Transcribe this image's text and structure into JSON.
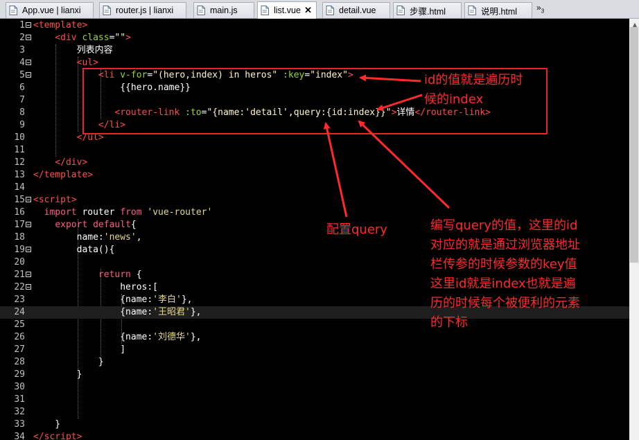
{
  "tabs": [
    {
      "label": "App.vue | lianxi",
      "active": false
    },
    {
      "label": "router.js | lianxi",
      "active": false
    },
    {
      "label": "main.js",
      "active": false
    },
    {
      "label": "list.vue",
      "active": true
    },
    {
      "label": "detail.vue",
      "active": false
    },
    {
      "label": "步骤.html",
      "active": false
    },
    {
      "label": "说明.html",
      "active": false
    }
  ],
  "tab_overflow": "»",
  "tab_overflow_count": "3",
  "code_lines": [
    {
      "n": "1",
      "fold": true,
      "t": "<span class='tg'>&lt;template&gt;</span>"
    },
    {
      "n": "2",
      "fold": true,
      "t": "    <span class='tg'>&lt;div</span> <span class='at'>class</span>=<span class='st'>\"\"</span><span class='tg'>&gt;</span>"
    },
    {
      "n": "3",
      "fold": false,
      "t": "        <span class='cn'>列表内容</span>"
    },
    {
      "n": "4",
      "fold": true,
      "t": "        <span class='tg'>&lt;ul&gt;</span>"
    },
    {
      "n": "5",
      "fold": true,
      "t": "            <span class='tg'>&lt;li</span> <span class='at'>v-for</span>=<span class='st'>\"(hero,index) in heros\"</span> <span class='at'>:key</span>=<span class='st'>\"index\"</span><span class='tg'>&gt;</span>"
    },
    {
      "n": "6",
      "fold": false,
      "t": "                {{hero.name}}"
    },
    {
      "n": "7",
      "fold": false,
      "t": ""
    },
    {
      "n": "8",
      "fold": false,
      "t": "               <span class='tg'>&lt;router-link</span> <span class='at'>:to</span>=<span class='st'>\"{name:'detail',query:{id:index}}\"</span><span class='tg'>&gt;</span><span class='cn'>详情</span><span class='tg'>&lt;/router-link&gt;</span>"
    },
    {
      "n": "9",
      "fold": false,
      "t": "            <span class='tg'>&lt;/li&gt;</span>"
    },
    {
      "n": "10",
      "fold": false,
      "t": "        <span class='tg'>&lt;/ul&gt;</span>"
    },
    {
      "n": "11",
      "fold": false,
      "t": ""
    },
    {
      "n": "12",
      "fold": false,
      "t": "    <span class='tg'>&lt;/div&gt;</span>"
    },
    {
      "n": "13",
      "fold": false,
      "t": "<span class='tg'>&lt;/template&gt;</span>"
    },
    {
      "n": "14",
      "fold": false,
      "t": ""
    },
    {
      "n": "15",
      "fold": true,
      "t": "<span class='tg'>&lt;script&gt;</span>"
    },
    {
      "n": "16",
      "fold": false,
      "t": "  <span class='kw'>import</span> router <span class='kw'>from</span> <span class='str'>'vue-router'</span>"
    },
    {
      "n": "17",
      "fold": true,
      "t": "    <span class='kw'>export</span> <span class='kw'>default</span>{"
    },
    {
      "n": "18",
      "fold": false,
      "t": "        name:<span class='str'>'news'</span>,"
    },
    {
      "n": "19",
      "fold": true,
      "t": "        data(){"
    },
    {
      "n": "20",
      "fold": false,
      "t": ""
    },
    {
      "n": "21",
      "fold": true,
      "t": "            <span class='kw'>return</span> {"
    },
    {
      "n": "22",
      "fold": true,
      "t": "                heros:["
    },
    {
      "n": "23",
      "fold": false,
      "t": "                {name:<span class='str'>'<span class='cn'>李白</span>'</span>},"
    },
    {
      "n": "24",
      "fold": false,
      "t": "                {name:<span class='str'>'<span class='cn'>王昭君</span>'</span>},"
    },
    {
      "n": "25",
      "fold": false,
      "t": ""
    },
    {
      "n": "26",
      "fold": false,
      "t": "                {name:<span class='str'>'<span class='cn'>刘德华</span>'</span>},"
    },
    {
      "n": "27",
      "fold": false,
      "t": "                ]"
    },
    {
      "n": "28",
      "fold": false,
      "t": "            }"
    },
    {
      "n": "29",
      "fold": false,
      "t": "        }"
    },
    {
      "n": "30",
      "fold": false,
      "t": ""
    },
    {
      "n": "31",
      "fold": false,
      "t": ""
    },
    {
      "n": "32",
      "fold": false,
      "t": ""
    },
    {
      "n": "33",
      "fold": false,
      "t": "    }"
    },
    {
      "n": "34",
      "fold": false,
      "t": "<span class='tg'>&lt;/script&gt;</span>"
    }
  ],
  "current_line": "24",
  "annotations": {
    "key_note_1": "id的值就是遍历时",
    "key_note_2": "候的index",
    "query_note": "配置query",
    "explain_1": "编写query的值，这里的id",
    "explain_2": "对应的就是通过浏览器地址",
    "explain_3": "栏传参的时候参数的key值",
    "explain_4": "这里id就是index也就是遍",
    "explain_5": "历的时候每个被便利的元素",
    "explain_6": "的下标"
  },
  "colors": {
    "background": "#000000",
    "annotation": "#ff2a2a",
    "tag": "#ff4d4d",
    "attribute": "#9ad33a",
    "keyword": "#ff5c82"
  }
}
